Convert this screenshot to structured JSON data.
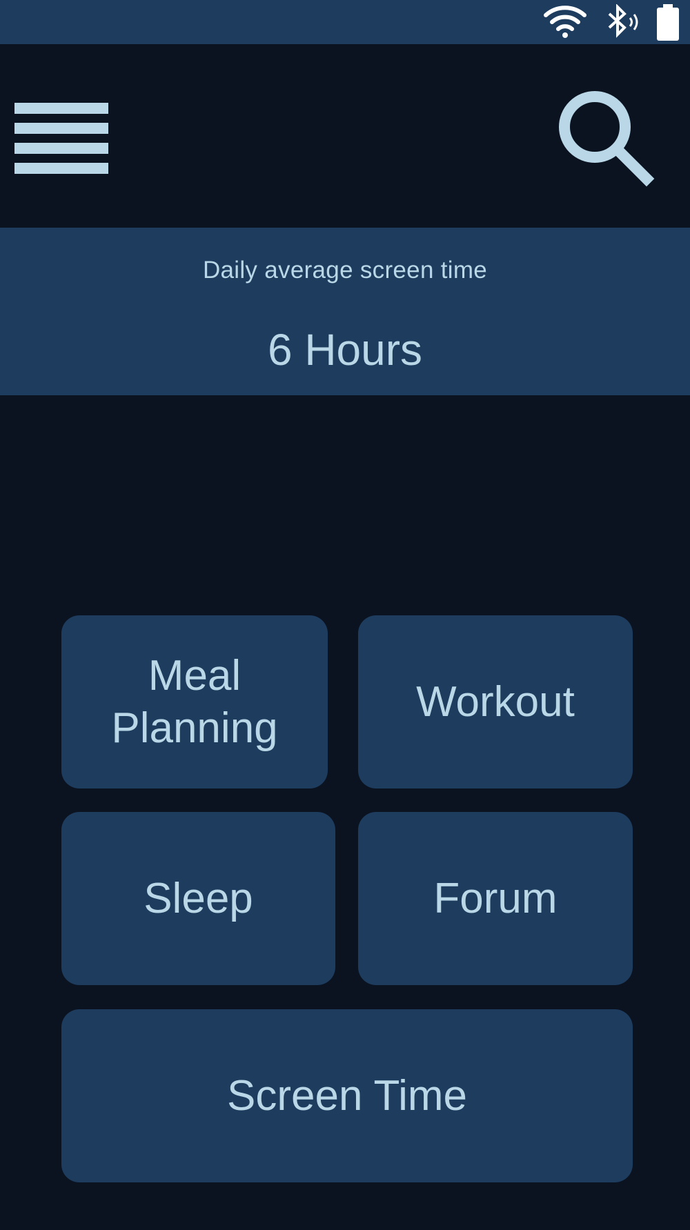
{
  "status_bar": {
    "icons": [
      "wifi-icon",
      "bluetooth-icon",
      "battery-icon"
    ]
  },
  "app_bar": {
    "menu_icon": "hamburger-menu-icon",
    "search_icon": "search-icon"
  },
  "summary": {
    "label": "Daily average screen time",
    "value": "6 Hours"
  },
  "tiles": [
    {
      "label": "Meal\nPlanning"
    },
    {
      "label": "Workout"
    },
    {
      "label": "Sleep"
    },
    {
      "label": "Forum"
    },
    {
      "label": "Screen Time"
    }
  ],
  "colors": {
    "background": "#0b1320",
    "surface": "#1d3c5e",
    "text": "#b9d7e6"
  }
}
